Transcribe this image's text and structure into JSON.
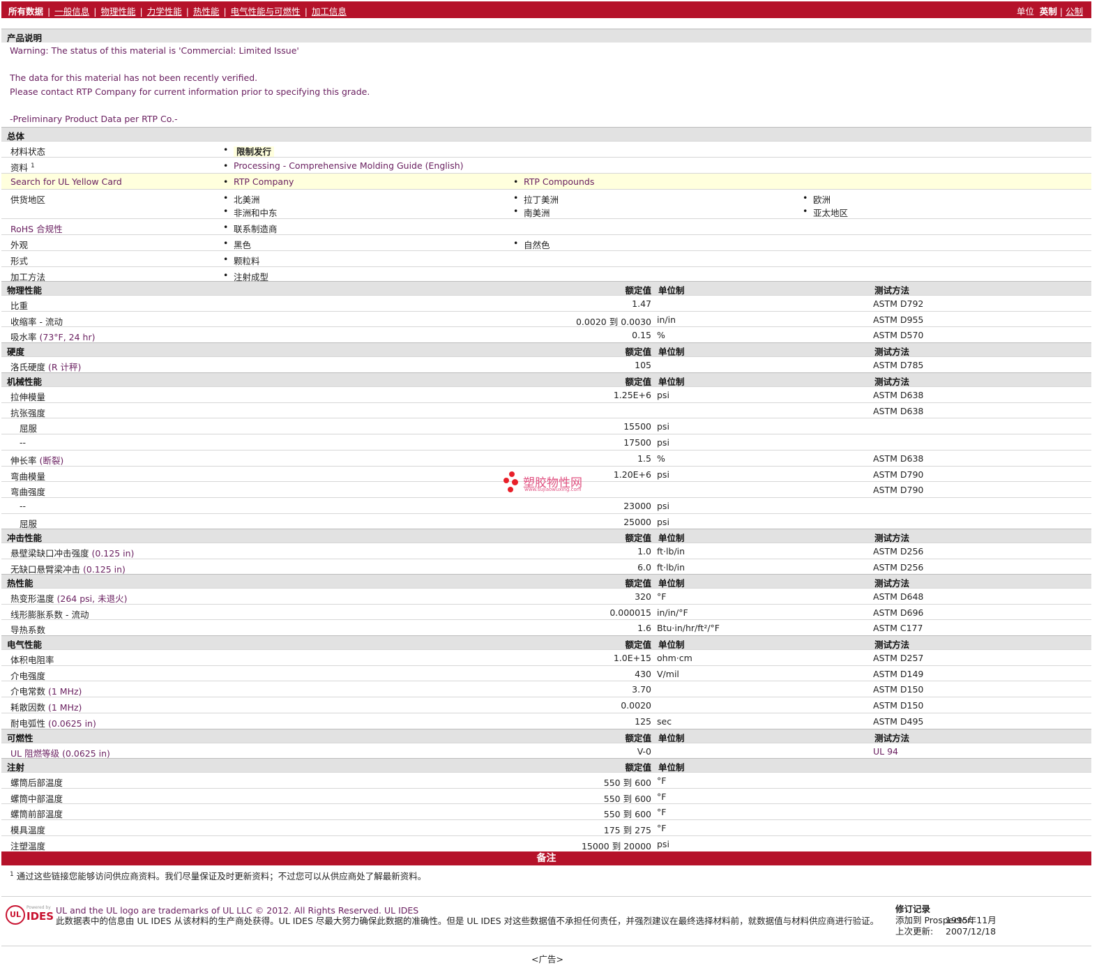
{
  "topnav": {
    "all_data": "所有数据",
    "links": [
      "一般信息",
      "物理性能",
      "力学性能",
      "热性能",
      "电气性能与可燃性",
      "加工信息"
    ],
    "units_label": "单位",
    "unit_imperial": "英制",
    "unit_metric": "公制"
  },
  "desc": {
    "title": "产品说明",
    "line1": "Warning: The status of this material is 'Commercial: Limited Issue'",
    "line2": "The data for this material has not been recently verified.",
    "line3": "Please contact RTP Company for current information prior to specifying this grade.",
    "line4": "-Preliminary Product Data per RTP Co.-"
  },
  "general": {
    "title": "总体",
    "status_label": "材料状态",
    "status_value": "限制发行",
    "docs_label": "资料",
    "docs_sup": "1",
    "docs_value": "Processing - Comprehensive Molding Guide (English)",
    "ul_label": "Search for UL Yellow Card",
    "ul_values": [
      "RTP Company",
      "RTP Compounds"
    ],
    "region_label": "供货地区",
    "regions": [
      "北美洲",
      "拉丁美洲",
      "欧洲",
      "非洲和中东",
      "南美洲",
      "亚太地区"
    ],
    "rohs_label": "RoHS 合规性",
    "rohs_value": "联系制造商",
    "appearance_label": "外观",
    "appearance": [
      "黑色",
      "自然色"
    ],
    "form_label": "形式",
    "form_value": "颗粒料",
    "process_label": "加工方法",
    "process_value": "注射成型"
  },
  "headers": {
    "value": "额定值",
    "unit": "单位制",
    "method": "测试方法"
  },
  "sections": {
    "physical": {
      "title": "物理性能",
      "rows": [
        {
          "label": "比重",
          "paren": "",
          "value": "1.47",
          "unit": "",
          "method": "ASTM D792"
        },
        {
          "label": "收缩率 - 流动",
          "paren": "",
          "value_from": "0.0020",
          "to": "到",
          "value_to": "0.0030",
          "unit": "in/in",
          "method": "ASTM D955"
        },
        {
          "label": "吸水率",
          "paren": "(73°F, 24 hr)",
          "value": "0.15",
          "unit": "%",
          "method": "ASTM D570"
        }
      ]
    },
    "hardness": {
      "title": "硬度",
      "rows": [
        {
          "label": "洛氏硬度",
          "paren": "(R 计秤)",
          "value": "105",
          "unit": "",
          "method": "ASTM D785"
        }
      ]
    },
    "mechanical": {
      "title": "机械性能",
      "rows": [
        {
          "label": "拉伸模量",
          "value": "1.25E+6",
          "unit": "psi",
          "method": "ASTM D638"
        },
        {
          "label": "抗张强度",
          "value": "",
          "unit": "",
          "method": "ASTM D638"
        },
        {
          "label": "屈服",
          "value": "15500",
          "unit": "psi",
          "method": ""
        },
        {
          "label": "--",
          "value": "17500",
          "unit": "psi",
          "method": ""
        },
        {
          "label": "伸长率",
          "paren": "(断裂)",
          "value": "1.5",
          "unit": "%",
          "method": "ASTM D638"
        },
        {
          "label": "弯曲模量",
          "value": "1.20E+6",
          "unit": "psi",
          "method": "ASTM D790"
        },
        {
          "label": "弯曲强度",
          "value": "",
          "unit": "",
          "method": "ASTM D790"
        },
        {
          "label": "--",
          "value": "23000",
          "unit": "psi",
          "method": ""
        },
        {
          "label": "屈服",
          "value": "25000",
          "unit": "psi",
          "method": ""
        }
      ]
    },
    "impact": {
      "title": "冲击性能",
      "rows": [
        {
          "label": "悬壁梁缺口冲击强度",
          "paren": "(0.125 in)",
          "value": "1.0",
          "unit": "ft·lb/in",
          "method": "ASTM D256"
        },
        {
          "label": "无缺口悬臂梁冲击",
          "paren": "(0.125 in)",
          "value": "6.0",
          "unit": "ft·lb/in",
          "method": "ASTM D256"
        }
      ]
    },
    "thermal": {
      "title": "热性能",
      "rows": [
        {
          "label": "热变形温度",
          "paren": "(264 psi, 未退火)",
          "value": "320",
          "unit": "°F",
          "method": "ASTM D648"
        },
        {
          "label": "线形膨胀系数 - 流动",
          "value": "0.000015",
          "unit": "in/in/°F",
          "method": "ASTM D696"
        },
        {
          "label": "导热系数",
          "value": "1.6",
          "unit": "Btu·in/hr/ft²/°F",
          "method": "ASTM C177"
        }
      ]
    },
    "electrical": {
      "title": "电气性能",
      "rows": [
        {
          "label": "体积电阻率",
          "value": "1.0E+15",
          "unit": "ohm·cm",
          "method": "ASTM D257"
        },
        {
          "label": "介电强度",
          "value": "430",
          "unit": "V/mil",
          "method": "ASTM D149"
        },
        {
          "label": "介电常数",
          "paren": "(1 MHz)",
          "value": "3.70",
          "unit": "",
          "method": "ASTM D150"
        },
        {
          "label": "耗散因数",
          "paren": "(1 MHz)",
          "value": "0.0020",
          "unit": "",
          "method": "ASTM D150"
        },
        {
          "label": "耐电弧性",
          "paren": "(0.0625 in)",
          "value": "125",
          "unit": "sec",
          "method": "ASTM D495"
        }
      ]
    },
    "flammability": {
      "title": "可燃性",
      "rows": [
        {
          "label": "UL 阻燃等级",
          "paren": "(0.0625 in)",
          "value": "V-0",
          "unit": "",
          "method": "UL 94"
        }
      ]
    },
    "injection": {
      "title": "注射",
      "rows": [
        {
          "label": "螺筒后部温度",
          "value_from": "550",
          "to": "到",
          "value_to": "600",
          "unit": "°F"
        },
        {
          "label": "螺筒中部温度",
          "value_from": "550",
          "to": "到",
          "value_to": "600",
          "unit": "°F"
        },
        {
          "label": "螺筒前部温度",
          "value_from": "550",
          "to": "到",
          "value_to": "600",
          "unit": "°F"
        },
        {
          "label": "模具温度",
          "value_from": "175",
          "to": "到",
          "value_to": "275",
          "unit": "°F"
        },
        {
          "label": "注塑温度",
          "value_from": "15000",
          "to": "到",
          "value_to": "20000",
          "unit": "psi"
        }
      ]
    }
  },
  "notes": {
    "title": "备注",
    "sup": "1",
    "text": "通过这些链接您能够访问供应商资料。我们尽量保证及时更新资料；不过您可以从供应商处了解最新资料。"
  },
  "footer": {
    "logo_powered": "Powered by",
    "logo_ul": "UL",
    "logo_text": "IDES",
    "line1": "UL and the UL logo are trademarks of UL LLC © 2012. All Rights Reserved. UL IDES",
    "line2": "此数据表中的信息由 UL IDES 从该材料的生产商处获得。UL IDES 尽最大努力确保此数据的准确性。但是 UL IDES 对这些数据值不承担任何责任，并强烈建议在最终选择材料前，就数据值与材料供应商进行验证。",
    "rev_title": "修订记录",
    "added_label": "添加到 Prospector:",
    "added_value": "1995年11月",
    "updated_label": "上次更新:",
    "updated_value": "2007/12/18",
    "ad": "<广告>"
  },
  "watermark": {
    "text": "塑胶物性网",
    "url": "www.sujiaowuxing.com"
  }
}
